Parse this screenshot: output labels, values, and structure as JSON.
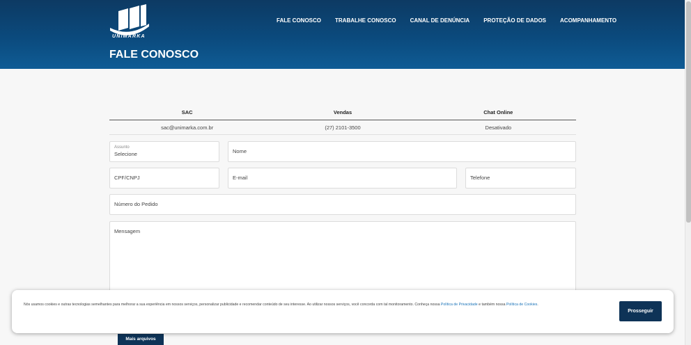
{
  "brand": {
    "name": "UNIMARKA"
  },
  "nav": {
    "items": [
      {
        "label": "FALE CONOSCO"
      },
      {
        "label": "TRABALHE CONOSCO"
      },
      {
        "label": "CANAL DE DENÚNCIA"
      },
      {
        "label": "PROTEÇÃO DE DADOS"
      },
      {
        "label": "ACOMPANHAMENTO"
      }
    ]
  },
  "page": {
    "title": "FALE CONOSCO"
  },
  "contacts": {
    "headers": [
      "SAC",
      "Vendas",
      "Chat Online"
    ],
    "values": [
      "sac@unimarka.com.br",
      "(27) 2101-3500",
      "Desativado"
    ]
  },
  "form": {
    "subject_label": "Assunto",
    "subject_value": "Selecione",
    "name_label": "Nome",
    "cpf_label": "CPF/CNPJ",
    "email_label": "E-mail",
    "phone_label": "Telefone",
    "order_label": "Número do Pedido",
    "message_label": "Mensagem",
    "more_files_label": "Mais arquivos"
  },
  "cookie": {
    "text_before": "Nós usamos cookies e outras tecnologias semelhantes para melhorar a sua experiência em nossos serviços, personalizar publicidade e recomendar conteúdo de seu interesse. Ao utilizar nossos serviços, você concorda com tal monitoramento. Conheça nossa ",
    "privacy_link": "Política de Privacidade",
    "text_middle": " e também nossa ",
    "cookies_link": "Política de Cookies",
    "text_after": ".",
    "button_label": "Prosseguir"
  },
  "colors": {
    "header_bg": "#0b4a7d",
    "button_bg": "#0e3357",
    "link": "#1a73b8"
  }
}
